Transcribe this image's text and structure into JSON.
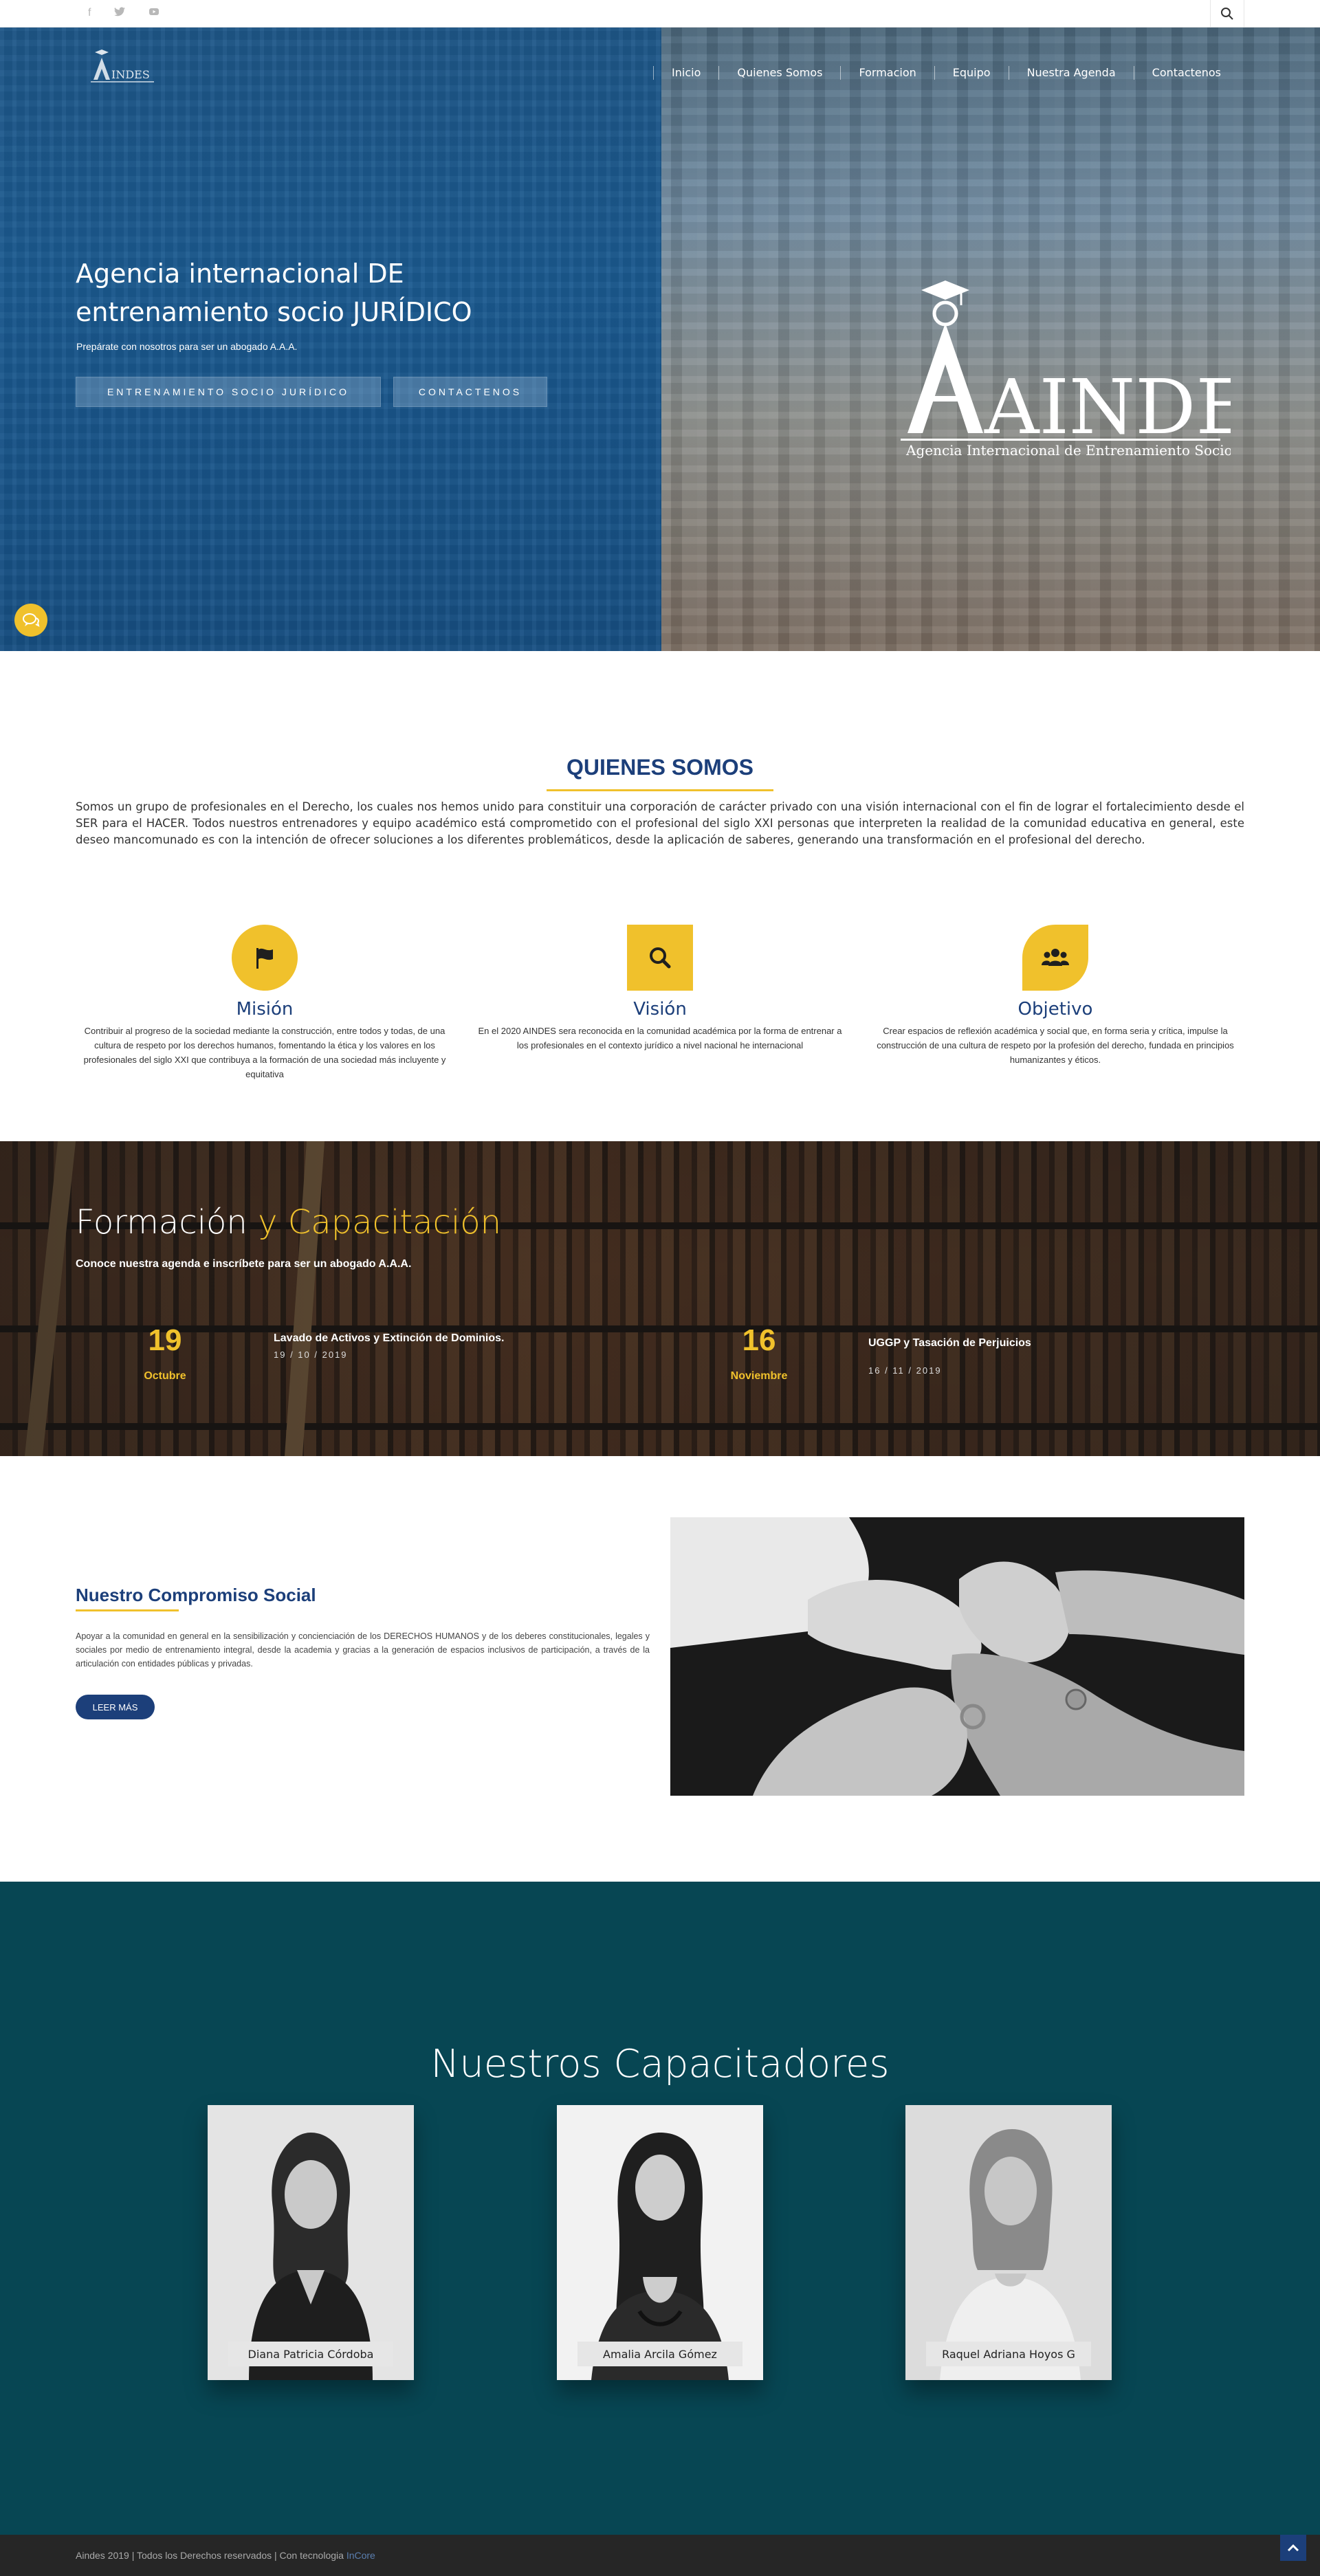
{
  "topbar": {
    "social_icons": [
      "facebook-icon",
      "twitter-icon",
      "youtube-icon"
    ],
    "search_icon": "search-icon"
  },
  "nav": {
    "items": [
      "Inicio",
      "Quienes Somos",
      "Formacion",
      "Equipo",
      "Nuestra Agenda",
      "Contactenos"
    ]
  },
  "hero": {
    "title": "Agencia internacional DE entrenamiento socio JURÍDICO",
    "subtitle": "Prepárate con nosotros para ser un abogado A.A.A.",
    "button_primary": "ENTRENAMIENTO SOCIO JURÍDICO",
    "button_secondary": "CONTACTENOS",
    "logo_text": "AINDES",
    "logo_tagline": "Agencia Internacional de Entrenamiento Socio - Jurídico"
  },
  "quienes_somos": {
    "title": "QUIENES SOMOS",
    "text": "Somos un grupo de profesionales en el Derecho, los cuales nos hemos unido para constituir una corporación de carácter privado con una visión internacional con el fin de lograr el fortalecimiento desde el SER para el HACER. Todos nuestros entrenadores y equipo académico está comprometido con el profesional del siglo XXI personas que interpreten la realidad de la comunidad educativa en general, este deseo mancomunado es con la intención de ofrecer soluciones a los diferentes problemáticos, desde la aplicación de saberes, generando una transformación en el profesional del derecho."
  },
  "features": [
    {
      "icon": "flag-icon",
      "title": "Misión",
      "text": "Contribuir al progreso de la sociedad mediante la construcción, entre todos y todas, de una cultura de respeto por los derechos humanos, fomentando la ética y los valores en los profesionales del siglo XXI que contribuya a la formación de una sociedad más incluyente y equitativa"
    },
    {
      "icon": "search-icon",
      "title": "Visión",
      "text": "En el 2020 AINDES sera reconocida en la comunidad académica por la forma de entrenar a los profesionales en el contexto jurídico a nivel nacional he internacional"
    },
    {
      "icon": "users-icon",
      "title": "Objetivo",
      "text": "Crear espacios de reflexión académica y social que, en forma seria y crítica, impulse la construcción de una cultura de respeto por la profesión del derecho, fundada en principios humanizantes y éticos."
    }
  ],
  "formacion": {
    "title_part1": "Formación",
    "title_part2": "y Capacitación",
    "subtitle": "Conoce nuestra agenda e inscríbete para ser un abogado A.A.A.",
    "events": [
      {
        "day": "19",
        "month": "Octubre",
        "title": "Lavado de Activos y Extinción de Dominios.",
        "date": "19 / 10 / 2019"
      },
      {
        "day": "16",
        "month": "Noviembre",
        "title": "UGGP y Tasación de Perjuicios",
        "date": "16 / 11 / 2019"
      }
    ]
  },
  "compromiso": {
    "title": "Nuestro Compromiso Social",
    "text": "Apoyar a la comunidad en general en la sensibilización y concienciación de los DERECHOS HUMANOS y de los deberes constitucionales, legales y sociales por medio de entrenamiento integral, desde la academia y gracias a la generación de espacios inclusivos de participación, a través de la articulación con entidades públicas y privadas.",
    "button": "LEER MÁS"
  },
  "capacitadores": {
    "title": "Nuestros Capacitadores",
    "people": [
      "Diana Patricia Córdoba",
      "Amalia Arcila Gómez",
      "Raquel Adriana Hoyos G"
    ]
  },
  "footer": {
    "text": "Aindes 2019 | Todos los Derechos reservados | Con tecnologia",
    "link": "InCore"
  },
  "colors": {
    "brand_blue": "#1c3f7a",
    "accent_yellow": "#f0c12c",
    "teal_section": "#074653",
    "footer_bg": "#262626"
  }
}
